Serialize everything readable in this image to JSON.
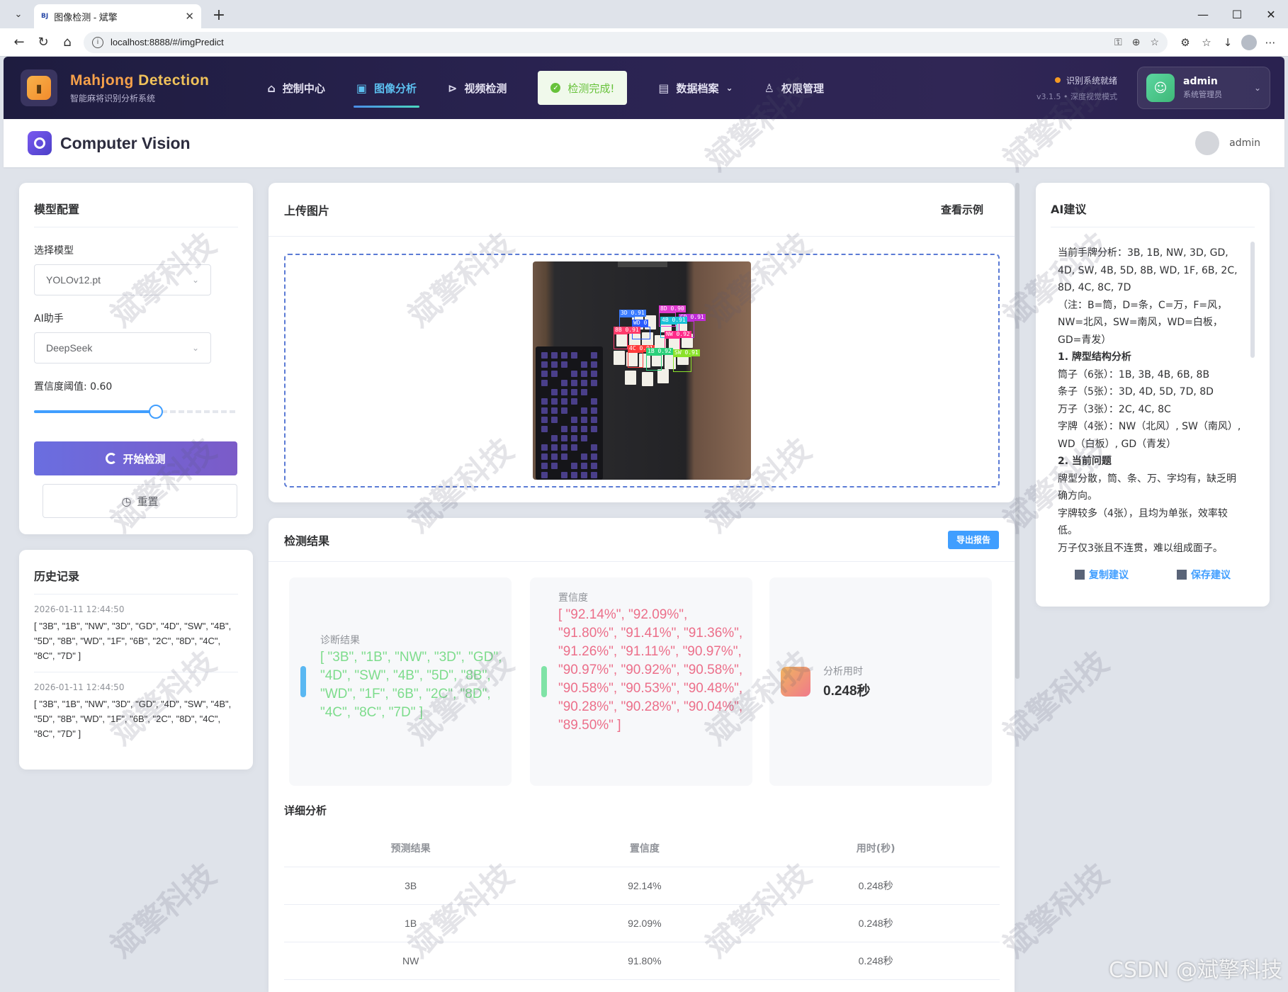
{
  "browser": {
    "tab_title": "图像检测 - 斌擎",
    "url": "localhost:8888/#/imgPredict"
  },
  "header": {
    "brand_word1": "Mahjong",
    "brand_word2": "Detection",
    "brand_sub": "智能麻将识别分析系统",
    "nav": [
      {
        "label": "控制中心",
        "icon": "home-icon"
      },
      {
        "label": "图像分析",
        "icon": "image-icon",
        "active": true
      },
      {
        "label": "视频检测",
        "icon": "play-icon"
      },
      {
        "label": "数据档案",
        "icon": "document-icon"
      },
      {
        "label": "权限管理",
        "icon": "user-icon"
      }
    ],
    "toast": "检测完成!",
    "status_line": "识别系统就绪",
    "version_line": "v3.1.5 • 深度视觉模式",
    "user_name": "admin",
    "user_role": "系统管理员"
  },
  "subheader": {
    "title": "Computer Vision",
    "user": "admin"
  },
  "config": {
    "title": "模型配置",
    "model_label": "选择模型",
    "model_value": "YOLOv12.pt",
    "ai_label": "AI助手",
    "ai_value": "DeepSeek",
    "confidence_label": "置信度阈值: 0.60",
    "confidence_value": 0.6,
    "start_btn": "开始检测",
    "reset_btn": "重置"
  },
  "history": {
    "title": "历史记录",
    "items": [
      {
        "time": "2026-01-11 12:44:50",
        "text": "[ \"3B\", \"1B\", \"NW\", \"3D\", \"GD\", \"4D\", \"SW\", \"4B\", \"5D\", \"8B\", \"WD\", \"1F\", \"6B\", \"2C\", \"8D\", \"4C\", \"8C\", \"7D\" ]"
      },
      {
        "time": "2026-01-11 12:44:50",
        "text": "[ \"3B\", \"1B\", \"NW\", \"3D\", \"GD\", \"4D\", \"SW\", \"4B\", \"5D\", \"8B\", \"WD\", \"1F\", \"6B\", \"2C\", \"8D\", \"4C\", \"8C\", \"7D\" ]"
      }
    ]
  },
  "upload": {
    "title": "上传图片",
    "example_link": "查看示例"
  },
  "detections_overlay": [
    {
      "label": "3D 0.91",
      "color": "#3a7bff"
    },
    {
      "label": "8D 0.90",
      "color": "#e23bd0"
    },
    {
      "label": "GD 0.91",
      "color": "#c02bd8"
    },
    {
      "label": "WD 0",
      "color": "#2a5cff"
    },
    {
      "label": "4B 0.91",
      "color": "#19c2d8"
    },
    {
      "label": "8B 0.91",
      "color": "#ff3b6b"
    },
    {
      "label": "NW 0.92",
      "color": "#ff2b8a"
    },
    {
      "label": "4C 0.91",
      "color": "#ff3b3b"
    },
    {
      "label": "1B 0.92",
      "color": "#2bd07a"
    },
    {
      "label": "SW 0.91",
      "color": "#8be22b"
    }
  ],
  "results": {
    "title": "检测结果",
    "export_btn": "导出报告",
    "diagnosis_label": "诊断结果",
    "diagnosis_value": "[ \"3B\", \"1B\", \"NW\", \"3D\", \"GD\", \"4D\", \"SW\", \"4B\", \"5D\", \"8B\", \"WD\", \"1F\", \"6B\", \"2C\", \"8D\", \"4C\", \"8C\", \"7D\" ]",
    "confidence_label": "置信度",
    "confidence_value": "[ \"92.14%\", \"92.09%\", \"91.80%\", \"91.41%\", \"91.36%\", \"91.26%\", \"91.11%\", \"90.97%\", \"90.97%\", \"90.92%\", \"90.58%\", \"90.58%\", \"90.53%\", \"90.48%\", \"90.28%\", \"90.28%\", \"90.04%\", \"89.50%\" ]",
    "time_label": "分析用时",
    "time_value": "0.248秒",
    "detail_title": "详细分析",
    "columns": [
      "预测结果",
      "置信度",
      "用时(秒)"
    ],
    "rows": [
      [
        "3B",
        "92.14%",
        "0.248秒"
      ],
      [
        "1B",
        "92.09%",
        "0.248秒"
      ],
      [
        "NW",
        "91.80%",
        "0.248秒"
      ]
    ]
  },
  "ai": {
    "title": "AI建议",
    "paragraphs": [
      {
        "text": "当前手牌分析：3B, 1B, NW, 3D, GD, 4D, SW, 4B, 5D, 8B, WD, 1F, 6B, 2C, 8D, 4C, 8C, 7D",
        "bold": false
      },
      {
        "text": "（注：B=筒，D=条，C=万，F=风，NW=北风，SW=南风，WD=白板，GD=青发）",
        "bold": false
      },
      {
        "text": "1. 牌型结构分析",
        "bold": true
      },
      {
        "text": "筒子（6张）：1B, 3B, 4B, 6B, 8B",
        "bold": false
      },
      {
        "text": "条子（5张）：3D, 4D, 5D, 7D, 8D",
        "bold": false
      },
      {
        "text": "万子（3张）：2C, 4C, 8C",
        "bold": false
      },
      {
        "text": "字牌（4张）：NW（北风）, SW（南风）, WD（白板）, GD（青发）",
        "bold": false
      },
      {
        "text": "2. 当前问题",
        "bold": true
      },
      {
        "text": "牌型分散，筒、条、万、字均有，缺乏明确方向。",
        "bold": false
      },
      {
        "text": "字牌较多（4张），且均为单张，效率较低。",
        "bold": false
      },
      {
        "text": "万子仅3张且不连贯，难以组成面子。",
        "bold": false
      }
    ],
    "copy_btn": "复制建议",
    "save_btn": "保存建议"
  },
  "watermark_text": "斌擎科技",
  "credit": "CSDN @斌擎科技"
}
